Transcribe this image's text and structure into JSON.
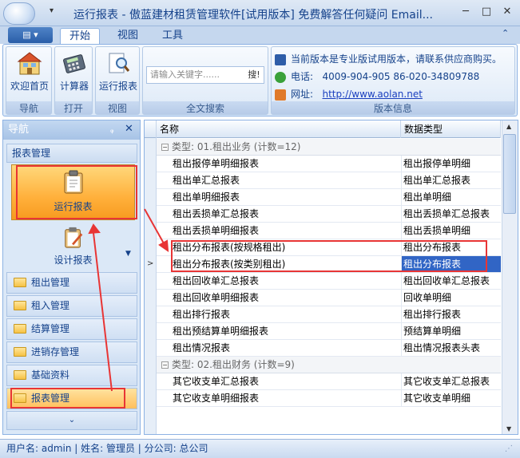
{
  "window": {
    "title": "运行报表 - 傲蓝建材租赁管理软件[试用版本] 免费解答任何疑问 Email...",
    "minimize": "─",
    "maximize": "□",
    "close": "✕"
  },
  "ribbon": {
    "menu_label": "▤ ▾",
    "tabs": [
      "开始",
      "视图",
      "工具"
    ],
    "groups": {
      "navigation": {
        "label": "导航",
        "buttons": [
          "欢迎首页"
        ]
      },
      "open": {
        "label": "打开",
        "buttons": [
          "计算器"
        ]
      },
      "view": {
        "label": "视图",
        "buttons": [
          "运行报表"
        ]
      },
      "search": {
        "label": "全文搜索",
        "placeholder": "请输入关键字......",
        "button": "搜!"
      },
      "info": {
        "label": "版本信息",
        "notice": "当前版本是专业版试用版本，请联系供应商购买。",
        "phone_label": "电话:",
        "phone": "4009-904-905  86-020-34809788",
        "site_label": "网址:",
        "site": "http://www.aolan.net"
      }
    }
  },
  "nav": {
    "title": "导航",
    "pin": "ᵩ",
    "close": "✕",
    "section": "报表管理",
    "run_report": "运行报表",
    "design_report": "设计报表",
    "items": [
      "租出管理",
      "租入管理",
      "结算管理",
      "进销存管理",
      "基础资料",
      "报表管理"
    ],
    "overflow": "⌄"
  },
  "grid": {
    "columns": [
      "名称",
      "数据类型"
    ],
    "groups": [
      {
        "header": "类型: 01.租出业务 (计数=12)",
        "rows": [
          [
            "租出报停单明细报表",
            "租出报停单明细"
          ],
          [
            "租出单汇总报表",
            "租出单汇总报表"
          ],
          [
            "租出单明细报表",
            "租出单明细"
          ],
          [
            "租出丢损单汇总报表",
            "租出丢损单汇总报表"
          ],
          [
            "租出丢损单明细报表",
            "租出丢损单明细"
          ],
          [
            "租出分布报表(按规格租出)",
            "租出分布报表"
          ],
          [
            "租出分布报表(按类别租出)",
            "租出分布报表"
          ],
          [
            "租出回收单汇总报表",
            "租出回收单汇总报表"
          ],
          [
            "租出回收单明细报表",
            "回收单明细"
          ],
          [
            "租出排行报表",
            "租出排行报表"
          ],
          [
            "租出预结算单明细报表",
            "预结算单明细"
          ],
          [
            "租出情况报表",
            "租出情况报表头表"
          ]
        ]
      },
      {
        "header": "类型: 02.租出财务 (计数=9)",
        "rows": [
          [
            "其它收支单汇总报表",
            "其它收支单汇总报表"
          ],
          [
            "其它收支单明细报表",
            "其它收支单明细"
          ]
        ]
      }
    ],
    "expander": "−",
    "current_row_marker": ">"
  },
  "status": {
    "text": "用户名: admin  | 姓名: 管理员  | 分公司: 总公司"
  },
  "colors": {
    "ribbon_blue": "#c5d7ee",
    "accent_orange": "#ffb03b",
    "selection": "#3165c5",
    "annotation_red": "#e83535"
  }
}
